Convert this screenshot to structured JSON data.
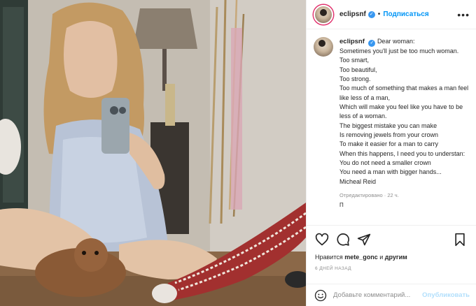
{
  "post": {
    "username": "eclipsnf",
    "follow_label": "Подписаться",
    "dot": "•",
    "more": "•••"
  },
  "caption": {
    "username": "eclipsnf",
    "lines": [
      "Dear woman:",
      "Sometimes you'll just be too much woman.",
      "Too smart,",
      "Too beautiful,",
      "Too strong.",
      "Too much of something that makes a man feel like less of a man,",
      "Which will make you feel like you have to be less of a woman.",
      "The biggest mistake you can make",
      "Is removing jewels from your crown",
      "To make it easier for a man to carry",
      "When this happens, I need you to understan:",
      "You do not need a smaller crown",
      "You need a man with bigger hands...",
      "Micheal Reid"
    ],
    "meta": "Отредактировано · 22 ч.",
    "truncated": "П"
  },
  "likes": {
    "prefix": "Нравится ",
    "user": "mete_gonc",
    "middle": " и ",
    "others": "другим"
  },
  "date": "6 ДНЕЙ НАЗАД",
  "comment": {
    "placeholder": "Добавьте комментарий...",
    "publish_label": "Опубликовать"
  },
  "colors": {
    "accent": "#0095f6",
    "publish_disabled": "#b2dffc",
    "meta_gray": "#8e8e8e",
    "verified": "#3897f0"
  }
}
